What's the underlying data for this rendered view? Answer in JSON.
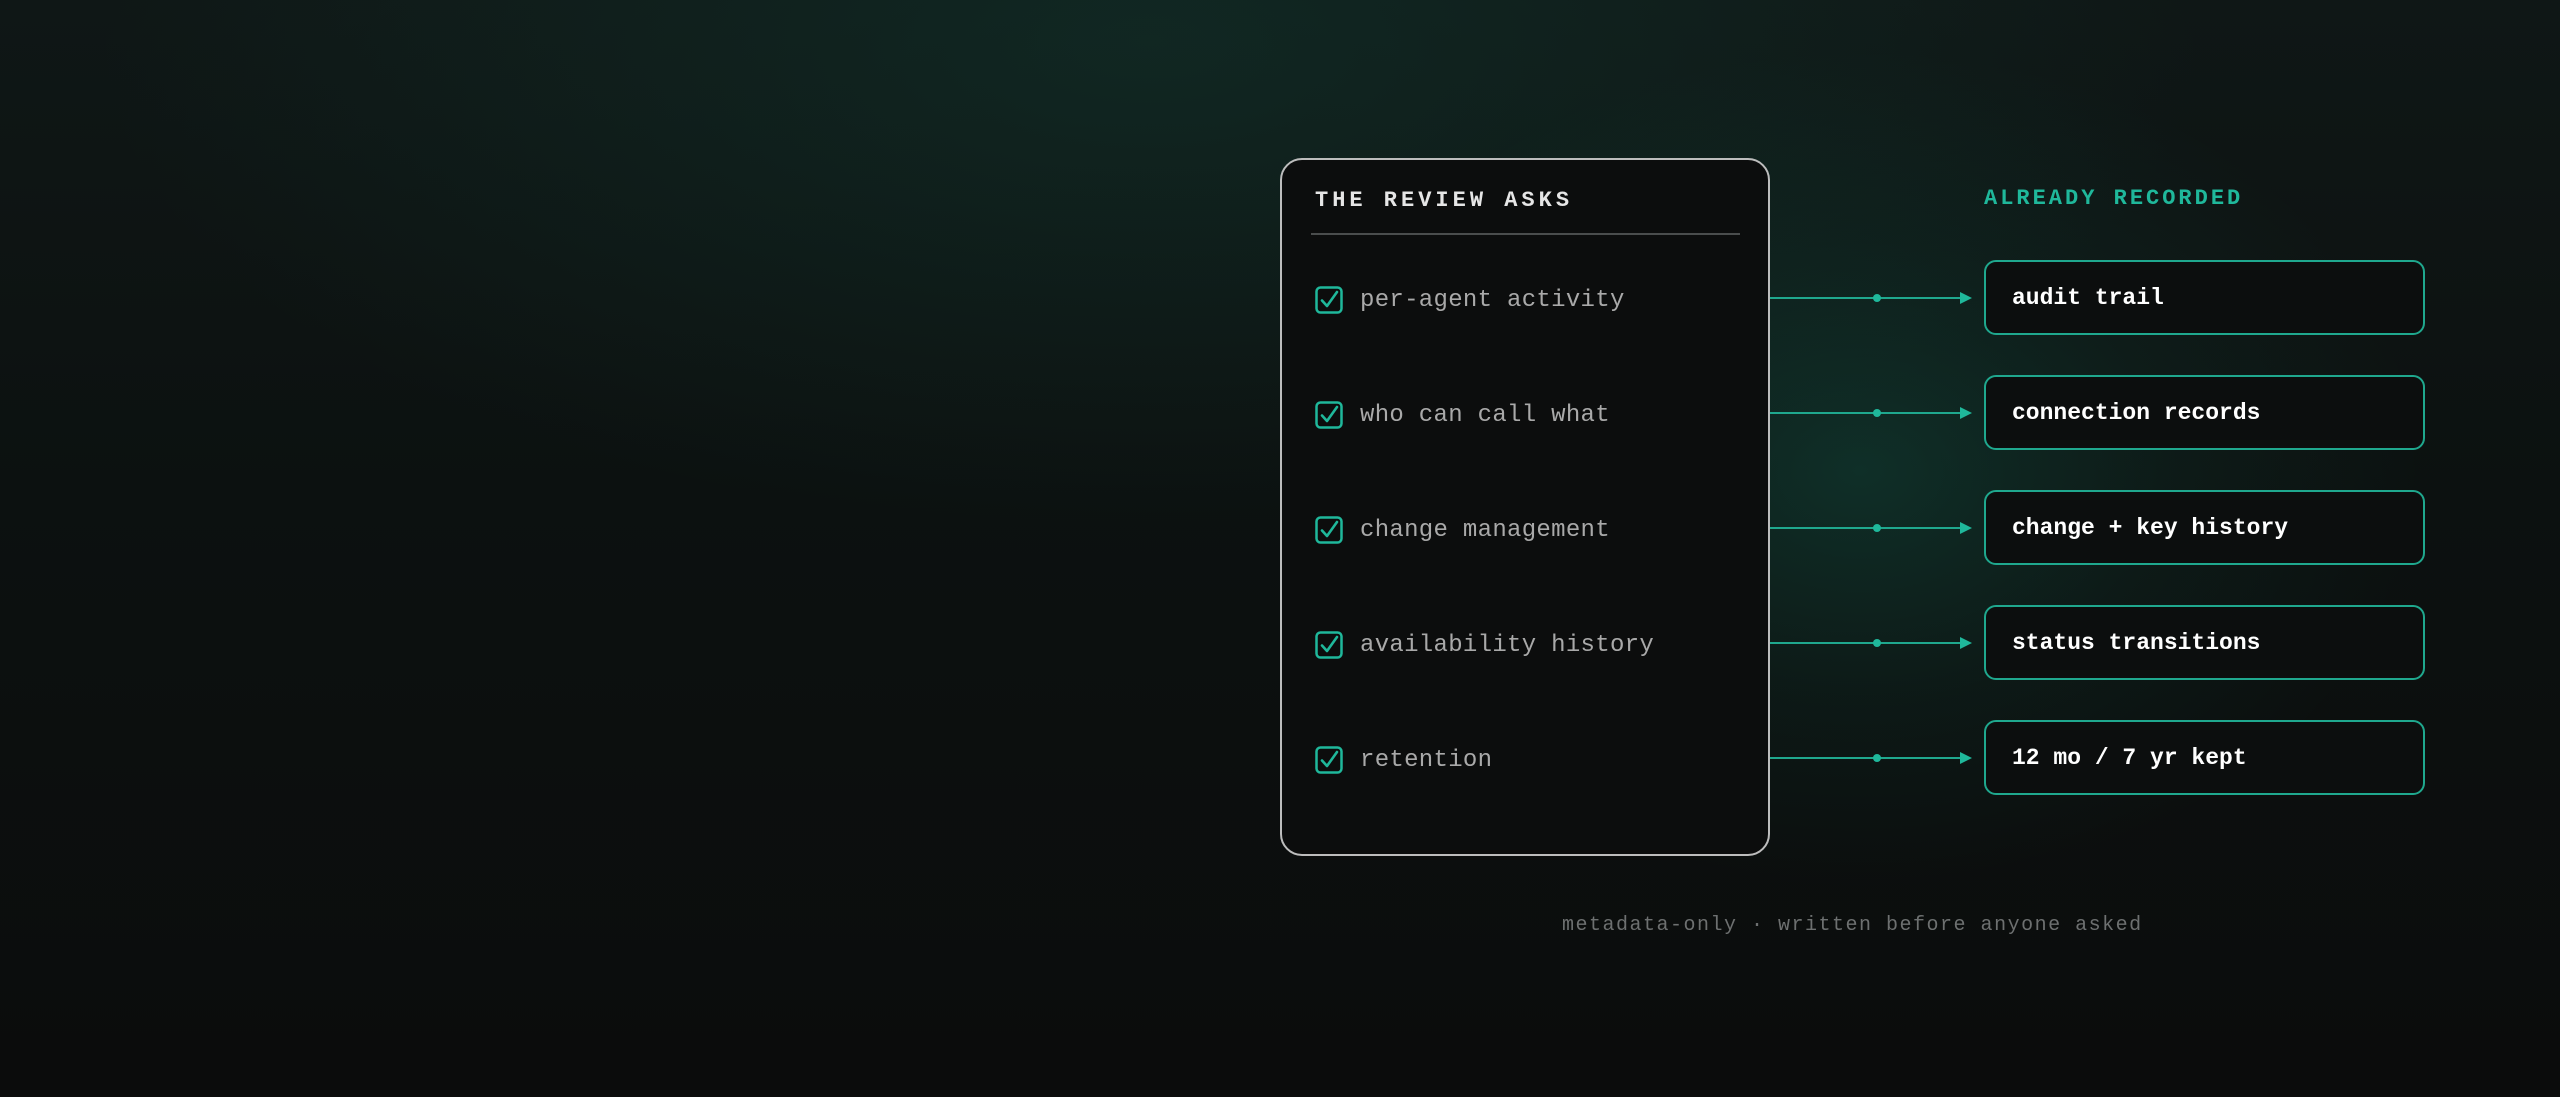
{
  "review": {
    "title": "THE REVIEW ASKS",
    "items": [
      {
        "label": "per-agent activity",
        "checked": true
      },
      {
        "label": "who can call what",
        "checked": true
      },
      {
        "label": "change management",
        "checked": true
      },
      {
        "label": "availability history",
        "checked": true
      },
      {
        "label": "retention",
        "checked": true
      }
    ]
  },
  "recorded": {
    "title": "ALREADY RECORDED",
    "items": [
      {
        "label": "audit trail"
      },
      {
        "label": "connection records"
      },
      {
        "label": "change + key history"
      },
      {
        "label": "status transitions"
      },
      {
        "label": "12 mo / 7 yr kept"
      }
    ]
  },
  "footer": "metadata-only · written before anyone asked",
  "colors": {
    "accent": "#1fb89b",
    "panel_border": "#bdbdbd",
    "muted_text": "#a9a9a9",
    "background": "#0b0c0c"
  },
  "icons": {
    "check": "checkbox-checked-icon",
    "connector": "arrow-right-icon"
  }
}
